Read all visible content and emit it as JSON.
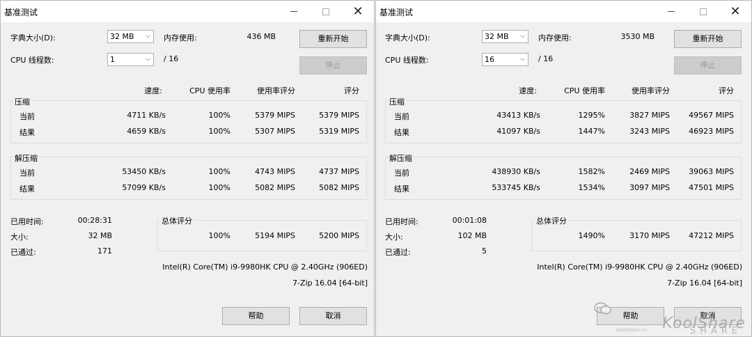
{
  "windows": [
    {
      "title": "基准测试",
      "dict_size_label": "字典大小(D):",
      "dict_size_value": "32 MB",
      "mem_label": "内存使用:",
      "mem_value": "436 MB",
      "threads_label": "CPU 线程数:",
      "threads_value": "1",
      "threads_total": "/ 16",
      "restart_label": "重新开始",
      "stop_label": "停止",
      "headers": {
        "speed": "速度:",
        "cpu": "CPU 使用率",
        "rating": "使用率评分",
        "score": "评分"
      },
      "compress": {
        "label": "压缩",
        "rows": [
          {
            "name": "当前",
            "speed": "4711 KB/s",
            "cpu": "100%",
            "rating": "5379 MIPS",
            "score": "5379 MIPS"
          },
          {
            "name": "结果",
            "speed": "4659 KB/s",
            "cpu": "100%",
            "rating": "5307 MIPS",
            "score": "5319 MIPS"
          }
        ]
      },
      "decompress": {
        "label": "解压缩",
        "rows": [
          {
            "name": "当前",
            "speed": "53450 KB/s",
            "cpu": "100%",
            "rating": "4743 MIPS",
            "score": "4737 MIPS"
          },
          {
            "name": "结果",
            "speed": "57099 KB/s",
            "cpu": "100%",
            "rating": "5082 MIPS",
            "score": "5082 MIPS"
          }
        ]
      },
      "elapsed_label": "已用时间:",
      "elapsed_value": "00:28:31",
      "size_label": "大小:",
      "size_value": "32 MB",
      "passes_label": "已通过:",
      "passes_value": "171",
      "total_label": "总体评分",
      "total_cpu": "100%",
      "total_rating": "5194 MIPS",
      "total_score": "5200 MIPS",
      "cpu_name": "Intel(R) Core(TM) i9-9980HK CPU @ 2.40GHz (906ED)",
      "version": "7-Zip 16.04 [64-bit]",
      "help_label": "帮助",
      "cancel_label": "取消"
    },
    {
      "title": "基准测试",
      "dict_size_label": "字典大小(D):",
      "dict_size_value": "32 MB",
      "mem_label": "内存使用:",
      "mem_value": "3530 MB",
      "threads_label": "CPU 线程数:",
      "threads_value": "16",
      "threads_total": "/ 16",
      "restart_label": "重新开始",
      "stop_label": "停止",
      "headers": {
        "speed": "速度:",
        "cpu": "CPU 使用率",
        "rating": "使用率评分",
        "score": "评分"
      },
      "compress": {
        "label": "压缩",
        "rows": [
          {
            "name": "当前",
            "speed": "43413 KB/s",
            "cpu": "1295%",
            "rating": "3827 MIPS",
            "score": "49567 MIPS"
          },
          {
            "name": "结果",
            "speed": "41097 KB/s",
            "cpu": "1447%",
            "rating": "3243 MIPS",
            "score": "46923 MIPS"
          }
        ]
      },
      "decompress": {
        "label": "解压缩",
        "rows": [
          {
            "name": "当前",
            "speed": "438930 KB/s",
            "cpu": "1582%",
            "rating": "2469 MIPS",
            "score": "39063 MIPS"
          },
          {
            "name": "结果",
            "speed": "533745 KB/s",
            "cpu": "1534%",
            "rating": "3097 MIPS",
            "score": "47501 MIPS"
          }
        ]
      },
      "elapsed_label": "已用时间:",
      "elapsed_value": "00:01:08",
      "size_label": "大小:",
      "size_value": "102 MB",
      "passes_label": "已通过:",
      "passes_value": "5",
      "total_label": "总体评分",
      "total_cpu": "1490%",
      "total_rating": "3170 MIPS",
      "total_score": "47212 MIPS",
      "cpu_name": "Intel(R) Core(TM) i9-9980HK CPU @ 2.40GHz (906ED)",
      "version": "7-Zip 16.04 [64-bit]",
      "help_label": "帮助",
      "cancel_label": "取消"
    }
  ],
  "watermark": {
    "brand": "KoolShare",
    "sub": "SHARE",
    "url": "koolshare.cn"
  }
}
